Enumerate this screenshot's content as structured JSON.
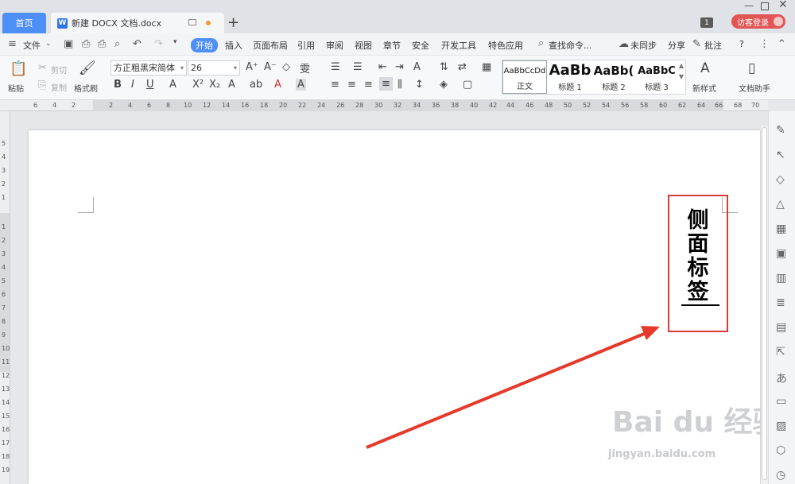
{
  "titlebar": {
    "home_tab": "首页",
    "doc_tab": "新建 DOCX 文档.docx",
    "new_tab_symbol": "+",
    "badge": "1",
    "login": "访客登录"
  },
  "menu": {
    "file": "文件",
    "items": [
      "开始",
      "插入",
      "页面布局",
      "引用",
      "审阅",
      "视图",
      "章节",
      "安全",
      "开发工具",
      "特色应用"
    ],
    "search": "查找命令...",
    "sync": "未同步",
    "share": "分享",
    "annotate": "批注",
    "help": "?"
  },
  "ribbon": {
    "paste": "粘贴",
    "cut": "剪切",
    "copy": "复制",
    "format_painter": "格式刷",
    "font_name": "方正粗黑宋简体",
    "font_size": "26",
    "styles": [
      {
        "sample": "AaBbCcDd",
        "name": "正文"
      },
      {
        "sample": "AaBb",
        "name": "标题 1"
      },
      {
        "sample": "AaBb(",
        "name": "标题 2"
      },
      {
        "sample": "AaBbC",
        "name": "标题 3"
      }
    ],
    "new_style": "新样式",
    "doc_helper": "文档助手"
  },
  "ruler": {
    "h_numbers": [
      "6",
      "4",
      "2",
      "2",
      "4",
      "6",
      "8",
      "10",
      "12",
      "14",
      "16",
      "18",
      "20",
      "22",
      "24",
      "26",
      "28",
      "30",
      "32",
      "34",
      "36",
      "38",
      "40",
      "42",
      "44",
      "46",
      "48",
      "50",
      "52",
      "54",
      "56",
      "58",
      "60",
      "62",
      "64",
      "66",
      "68",
      "70"
    ],
    "v_numbers": [
      "5",
      "4",
      "3",
      "2",
      "1",
      "1",
      "2",
      "3",
      "4",
      "5",
      "6",
      "7",
      "8",
      "9",
      "10",
      "11",
      "12",
      "13",
      "14",
      "15",
      "16",
      "17",
      "18",
      "19"
    ]
  },
  "document": {
    "side_label_chars": [
      "侧",
      "面",
      "标",
      "签"
    ]
  },
  "watermark": {
    "brand": "Bai du 经验",
    "url": "jingyan.baidu.com"
  },
  "colors": {
    "accent": "#4e8ef7",
    "highlight_red": "#d83a3a",
    "login_red": "#e35454"
  }
}
